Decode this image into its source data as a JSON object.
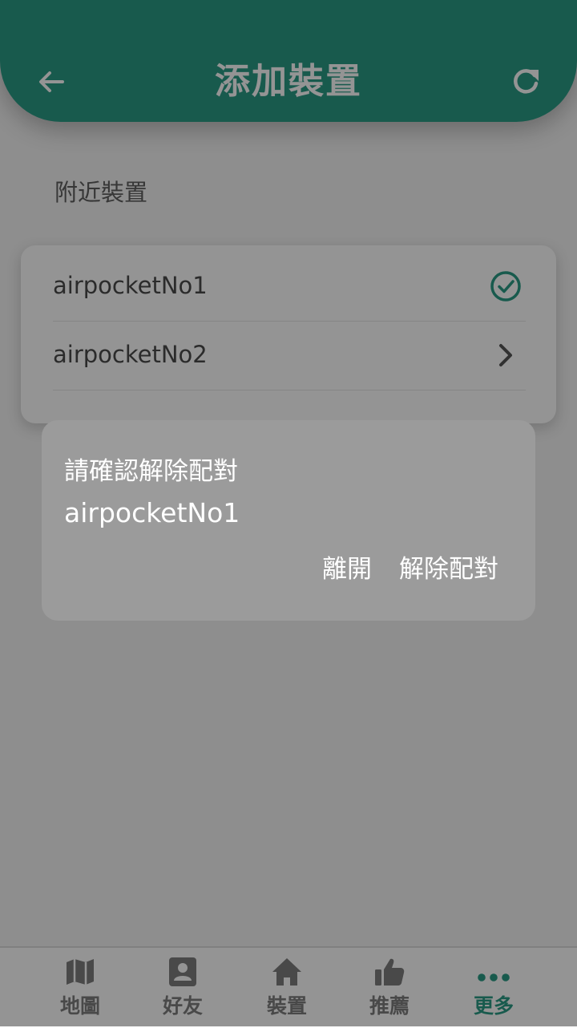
{
  "header": {
    "title": "添加裝置",
    "back_icon": "arrow-left-icon",
    "refresh_icon": "refresh-icon",
    "color": "#2a9b86"
  },
  "nearby": {
    "label": "附近裝置",
    "devices": [
      {
        "name": "airpocketNo1",
        "status_icon": "check-circle-icon"
      },
      {
        "name": "airpocketNo2",
        "status_icon": "chevron-right-icon"
      }
    ]
  },
  "dialog": {
    "message": "請確認解除配對",
    "device_name": "airpocketNo1",
    "leave_label": "離開",
    "unpair_label": "解除配對"
  },
  "nav": {
    "items": [
      {
        "label": "地圖",
        "icon": "map-icon"
      },
      {
        "label": "好友",
        "icon": "contact-icon"
      },
      {
        "label": "裝置",
        "icon": "home-icon"
      },
      {
        "label": "推薦",
        "icon": "thumbs-up-icon"
      },
      {
        "label": "更多",
        "icon": "more-dots-icon",
        "active": true
      }
    ],
    "active_color": "#2a9b86",
    "inactive_color": "#7e7e7e"
  }
}
